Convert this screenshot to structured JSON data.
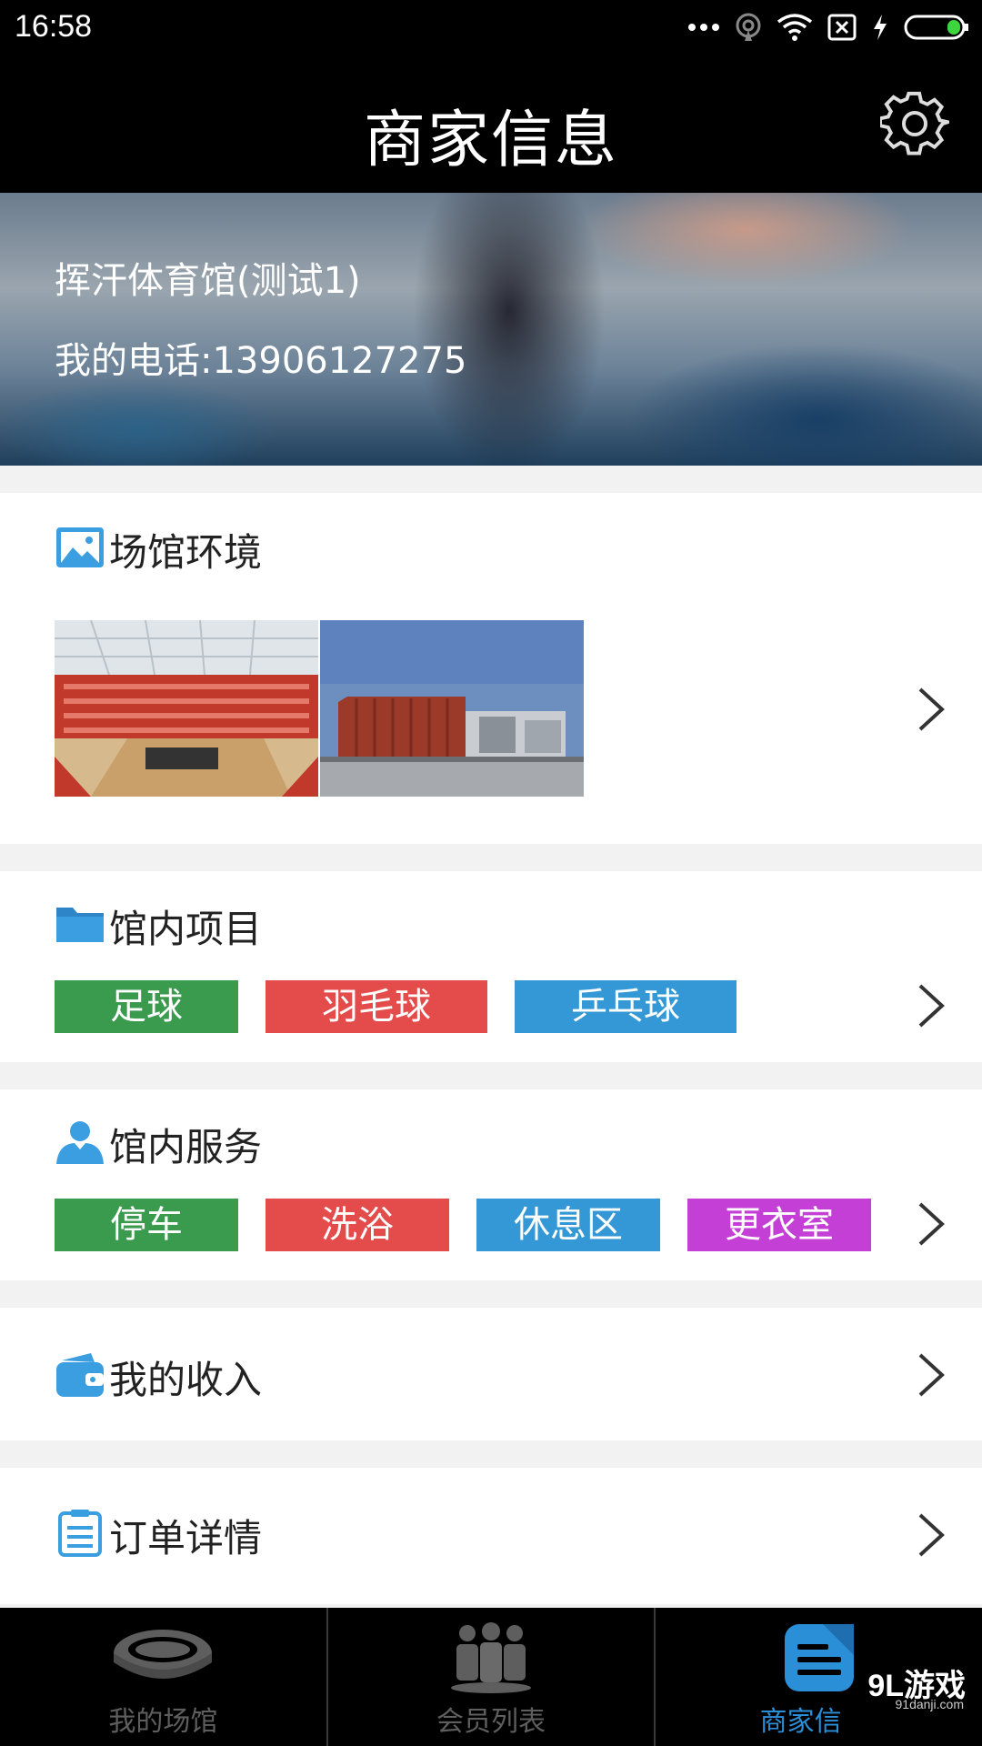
{
  "status_bar": {
    "time": "16:58"
  },
  "header": {
    "title": "商家信息",
    "settings_icon": "gear-icon"
  },
  "banner": {
    "name": "挥汗体育馆(测试1)",
    "phone": "我的电话:13906127275"
  },
  "sections": {
    "environment": {
      "title": "场馆环境",
      "icon": "image-icon"
    },
    "projects": {
      "title": "馆内项目",
      "icon": "folder-icon",
      "tags": [
        {
          "label": "足球",
          "color": "#3a9b4e"
        },
        {
          "label": "羽毛球",
          "color": "#e44b4b"
        },
        {
          "label": "乒乓球",
          "color": "#3598d6"
        }
      ]
    },
    "services": {
      "title": "馆内服务",
      "icon": "user-icon",
      "tags": [
        {
          "label": "停车",
          "color": "#3a9b4e"
        },
        {
          "label": "洗浴",
          "color": "#e44b4b"
        },
        {
          "label": "休息区",
          "color": "#3598d6"
        },
        {
          "label": "更衣室",
          "color": "#c43fd6"
        }
      ]
    },
    "income": {
      "title": "我的收入",
      "icon": "wallet-icon"
    },
    "orders": {
      "title": "订单详情",
      "icon": "clipboard-icon"
    }
  },
  "bottom_nav": [
    {
      "label": "我的场馆",
      "icon": "stadium-icon",
      "active": false
    },
    {
      "label": "会员列表",
      "icon": "members-icon",
      "active": false
    },
    {
      "label": "商家信",
      "icon": "document-icon",
      "active": true
    }
  ],
  "watermark": {
    "logo": "9L游戏",
    "url": "91danji.com"
  },
  "colors": {
    "accent": "#2b8fd8",
    "header_bg": "#000000",
    "icon_blue": "#3a9ee0"
  }
}
